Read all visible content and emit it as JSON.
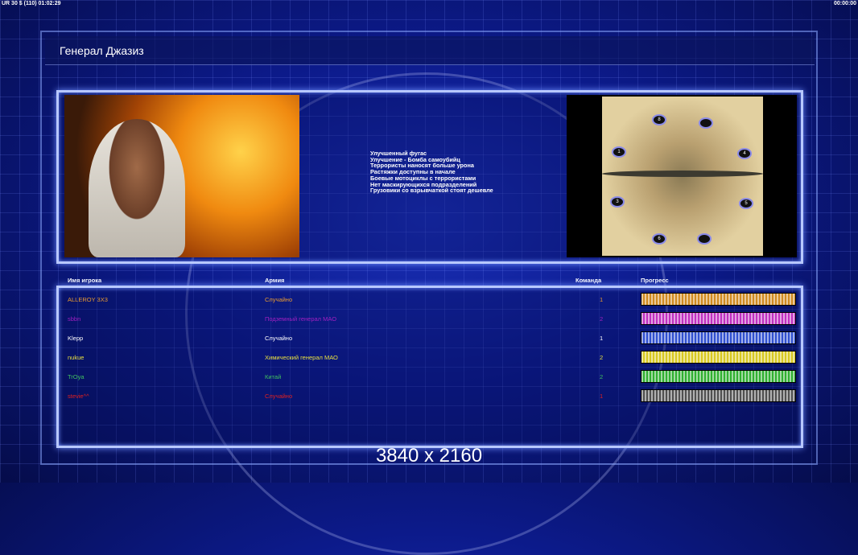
{
  "hud": {
    "left": "UR 30 $ (110) 01:02:29",
    "right": "00:00:00"
  },
  "title": "Генерал Джазиз",
  "features": [
    "Улучшенный фугас",
    "Улучшение - Бомба самоубийц",
    "Террористы наносят больше урона",
    "Растяжки доступны в начале",
    "Боевые мотоциклы с террористами",
    "Нет маскирующихся подразделений",
    "Грузовики со взрывчаткой стоят дешевле"
  ],
  "map_spots": [
    "8",
    "",
    "1",
    "4",
    "3",
    "5",
    "6",
    ""
  ],
  "table": {
    "headers": {
      "name": "Имя игрока",
      "army": "Армия",
      "team": "Команда",
      "progress": "Прогресс"
    },
    "rows": [
      {
        "name": "ALLEROY 3X3",
        "army": "Случайно",
        "team": "1",
        "color": "#e89a30",
        "progress": 100
      },
      {
        "name": "sbbn",
        "army": "Подземный генерал МАО",
        "team": "2",
        "color": "#a020c0",
        "progress": 100
      },
      {
        "name": "Klepp",
        "army": "Случайно",
        "team": "1",
        "color": "#ffffff",
        "progress": 100
      },
      {
        "name": "nukue",
        "army": "Химический генерал МАО",
        "team": "2",
        "color": "#e8e040",
        "progress": 100
      },
      {
        "name": "TrOya",
        "army": "Китай",
        "team": "2",
        "color": "#40c060",
        "progress": 100
      },
      {
        "name": "stevie^^",
        "army": "Случайно",
        "team": "1",
        "color": "#e02020",
        "progress": 100
      }
    ]
  },
  "bar_colors": [
    "#d08a20",
    "#c030c0",
    "#3050d0",
    "#d8c820",
    "#30b030",
    "#505050"
  ],
  "watermark": "3840 x 2160"
}
